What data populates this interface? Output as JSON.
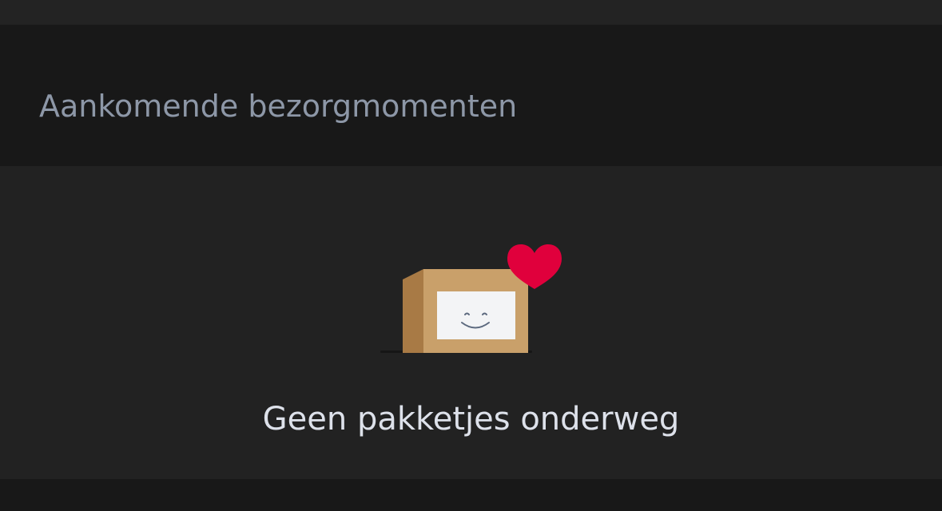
{
  "section": {
    "title": "Aankomende bezorgmomenten"
  },
  "empty_state": {
    "message": "Geen pakketjes onderweg",
    "icons": [
      "package-box-icon",
      "smiley-face-icon",
      "heart-icon"
    ]
  },
  "colors": {
    "header_background": "#181818",
    "page_background": "#222222",
    "title_text": "#8d97a7",
    "message_text": "#dde1ea",
    "box_front": "#c9a06a",
    "box_side": "#a87a45",
    "label": "#f3f4f6",
    "heart": "#e0003c"
  }
}
